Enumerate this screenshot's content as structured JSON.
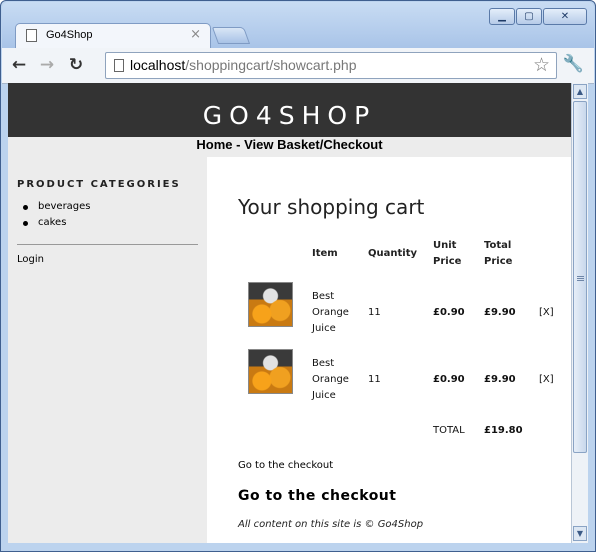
{
  "browser": {
    "tab_title": "Go4Shop",
    "tab_close": "×",
    "url_host": "localhost",
    "url_path": "/shoppingcart/showcart.php",
    "back_icon": "back-arrow-icon",
    "forward_icon": "forward-arrow-icon",
    "reload_icon": "reload-icon",
    "star_icon": "bookmark-star-icon",
    "wrench_icon": "wrench-icon"
  },
  "site": {
    "logo": "GO4SHOP",
    "nav": "Home - View Basket/Checkout"
  },
  "sidebar": {
    "heading": "PRODUCT CATEGORIES",
    "categories": [
      "beverages",
      "cakes"
    ],
    "login": "Login"
  },
  "cart": {
    "title": "Your shopping cart",
    "headers": {
      "item": "Item",
      "quantity": "Quantity",
      "unit_price": [
        "Unit",
        "Price"
      ],
      "total_price": [
        "Total",
        "Price"
      ]
    },
    "rows": [
      {
        "item": [
          "Best",
          "Orange",
          "Juice"
        ],
        "quantity": "11",
        "unit_price": "£0.90",
        "total_price": "£9.90",
        "remove": "[X]"
      },
      {
        "item": [
          "Best",
          "Orange",
          "Juice"
        ],
        "quantity": "11",
        "unit_price": "£0.90",
        "total_price": "£9.90",
        "remove": "[X]"
      }
    ],
    "total_label": "TOTAL",
    "total_value": "£19.80",
    "checkout_link": "Go to the checkout",
    "checkout_heading": "Go to the checkout"
  },
  "footer": "All content on this site is © Go4Shop"
}
